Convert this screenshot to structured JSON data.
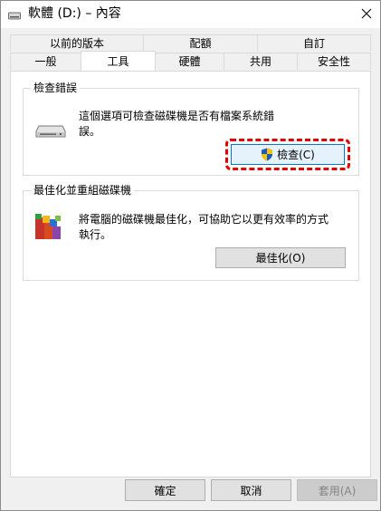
{
  "window": {
    "title": "軟體 (D:) – 內容"
  },
  "tabs": {
    "row1": [
      {
        "label": "以前的版本"
      },
      {
        "label": "配額"
      },
      {
        "label": "自訂"
      }
    ],
    "row2": [
      {
        "label": "一般"
      },
      {
        "label": "工具"
      },
      {
        "label": "硬體"
      },
      {
        "label": "共用"
      },
      {
        "label": "安全性"
      }
    ]
  },
  "error_check": {
    "title": "檢查錯誤",
    "description_line1": "這個選項可檢查磁碟機是否有檔案系統錯",
    "description_line2": "誤。",
    "button_label": "檢查(C)",
    "icon": "drive-icon"
  },
  "optimize": {
    "title": "最佳化並重組磁碟機",
    "description_line1": "將電腦的磁碟機最佳化，可協助它以更有效率的方式",
    "description_line2": "執行。",
    "button_label": "最佳化(O)",
    "icon": "defrag-icon"
  },
  "footer": {
    "ok_label": "確定",
    "cancel_label": "取消",
    "apply_label": "套用(A)"
  },
  "colors": {
    "highlight": "#e00000",
    "focus_border": "#0078d7"
  }
}
